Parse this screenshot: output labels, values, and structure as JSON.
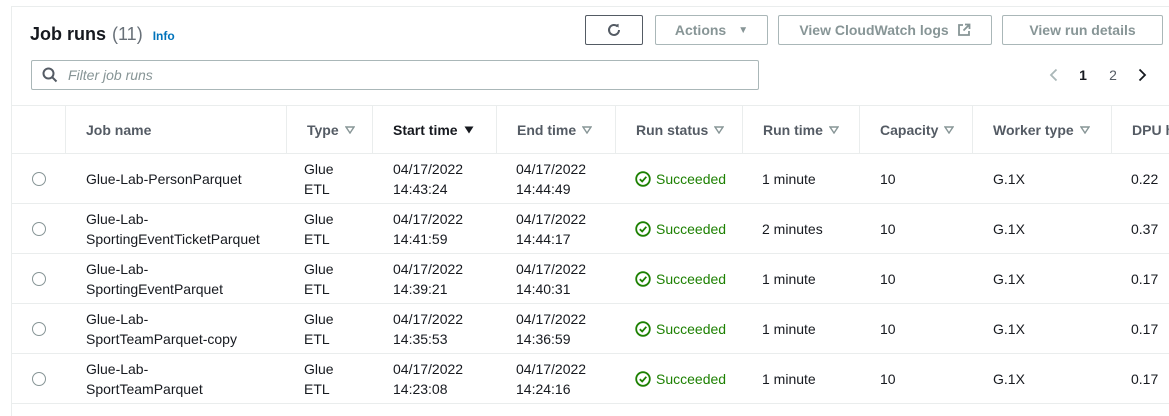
{
  "header": {
    "title": "Job runs",
    "count": "(11)",
    "info_label": "Info"
  },
  "toolbar": {
    "refresh_icon": "refresh-icon",
    "actions_label": "Actions",
    "cloudwatch_label": "View CloudWatch logs",
    "details_label": "View run details"
  },
  "search": {
    "placeholder": "Filter job runs",
    "value": ""
  },
  "pagination": {
    "current": "1",
    "next_page": "2"
  },
  "columns": {
    "job_name": "Job name",
    "type": "Type",
    "start_time": "Start time",
    "end_time": "End time",
    "run_status": "Run status",
    "run_time": "Run time",
    "capacity": "Capacity",
    "worker_type": "Worker type",
    "dpu_hours": "DPU h"
  },
  "rows": [
    {
      "job_name": [
        "Glue-Lab-PersonParquet"
      ],
      "type": [
        "Glue",
        "ETL"
      ],
      "start": [
        "04/17/2022",
        "14:43:24"
      ],
      "end": [
        "04/17/2022",
        "14:44:49"
      ],
      "status": "Succeeded",
      "run_time": "1 minute",
      "capacity": "10",
      "worker_type": "G.1X",
      "dpu": "0.22"
    },
    {
      "job_name": [
        "Glue-Lab-",
        "SportingEventTicketParquet"
      ],
      "type": [
        "Glue",
        "ETL"
      ],
      "start": [
        "04/17/2022",
        "14:41:59"
      ],
      "end": [
        "04/17/2022",
        "14:44:17"
      ],
      "status": "Succeeded",
      "run_time": "2 minutes",
      "capacity": "10",
      "worker_type": "G.1X",
      "dpu": "0.37"
    },
    {
      "job_name": [
        "Glue-Lab-",
        "SportingEventParquet"
      ],
      "type": [
        "Glue",
        "ETL"
      ],
      "start": [
        "04/17/2022",
        "14:39:21"
      ],
      "end": [
        "04/17/2022",
        "14:40:31"
      ],
      "status": "Succeeded",
      "run_time": "1 minute",
      "capacity": "10",
      "worker_type": "G.1X",
      "dpu": "0.17"
    },
    {
      "job_name": [
        "Glue-Lab-",
        "SportTeamParquet-copy"
      ],
      "type": [
        "Glue",
        "ETL"
      ],
      "start": [
        "04/17/2022",
        "14:35:53"
      ],
      "end": [
        "04/17/2022",
        "14:36:59"
      ],
      "status": "Succeeded",
      "run_time": "1 minute",
      "capacity": "10",
      "worker_type": "G.1X",
      "dpu": "0.17"
    },
    {
      "job_name": [
        "Glue-Lab-",
        "SportTeamParquet"
      ],
      "type": [
        "Glue",
        "ETL"
      ],
      "start": [
        "04/17/2022",
        "14:23:08"
      ],
      "end": [
        "04/17/2022",
        "14:24:16"
      ],
      "status": "Succeeded",
      "run_time": "1 minute",
      "capacity": "10",
      "worker_type": "G.1X",
      "dpu": "0.17"
    }
  ],
  "colors": {
    "success": "#1d8102",
    "link": "#0073bb",
    "border": "#eaeded",
    "muted": "#879596"
  }
}
